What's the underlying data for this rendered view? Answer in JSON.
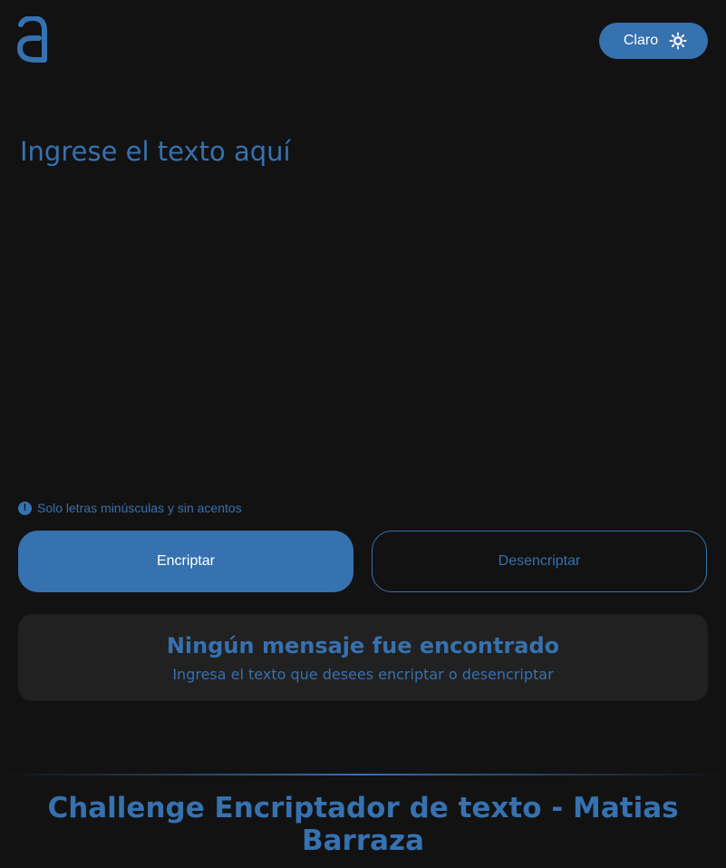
{
  "header": {
    "logo_icon": "letter-a-logo-icon",
    "theme_toggle": {
      "label": "Claro",
      "icon": "sun-icon"
    }
  },
  "editor": {
    "placeholder": "Ingrese el texto aquí",
    "value": ""
  },
  "hint": {
    "icon": "info-icon",
    "icon_glyph": "!",
    "text": "Solo letras minúsculas y sin acentos"
  },
  "actions": {
    "encrypt_label": "Encriptar",
    "decrypt_label": "Desencriptar"
  },
  "output": {
    "title": "Ningún mensaje fue encontrado",
    "subtitle": "Ingresa el texto que desees encriptar o desencriptar"
  },
  "footer": {
    "title": "Challenge Encriptador de texto - Matias Barraza"
  },
  "colors": {
    "background": "#121212",
    "accent": "#3671b0",
    "panel": "#212121",
    "button_text": "#ffffff"
  }
}
